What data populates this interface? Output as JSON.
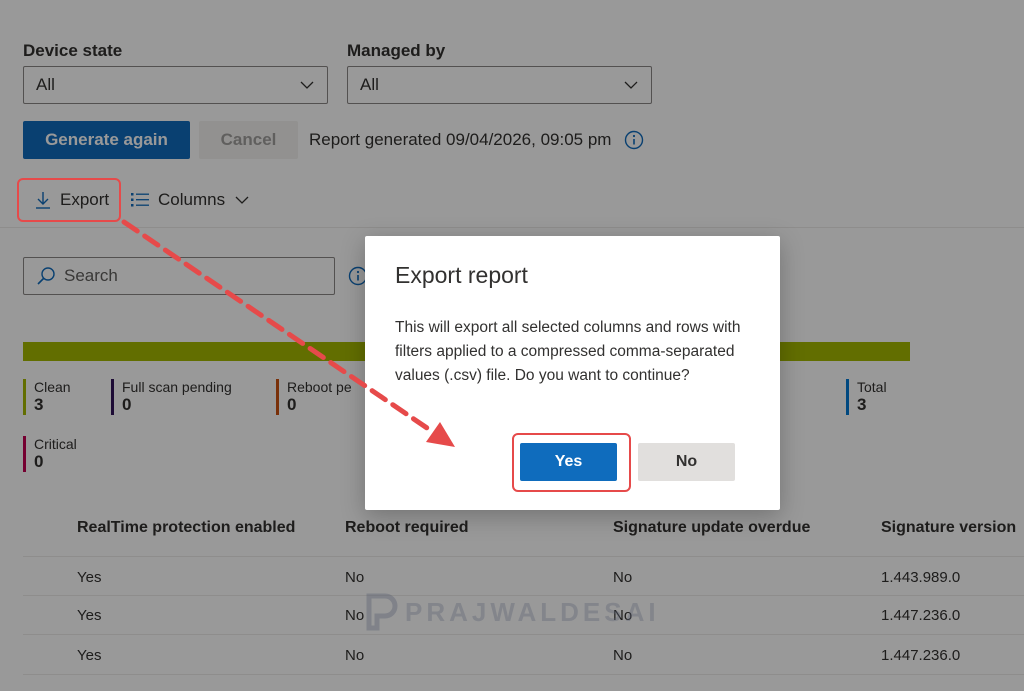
{
  "filters": {
    "device_state": {
      "label": "Device state",
      "value": "All"
    },
    "managed_by": {
      "label": "Managed by",
      "value": "All"
    }
  },
  "actions": {
    "generate_label": "Generate again",
    "cancel_label": "Cancel",
    "report_status": "Report generated 09/04/2026, 09:05 pm"
  },
  "commands": {
    "export_label": "Export",
    "columns_label": "Columns"
  },
  "search": {
    "placeholder": "Search"
  },
  "summary": {
    "bar_color": "#a4b800",
    "metrics": [
      {
        "name": "Clean",
        "value": "3",
        "color": "#a4b800"
      },
      {
        "name": "Full scan pending",
        "value": "0",
        "color": "#32145a"
      },
      {
        "name": "Reboot pe",
        "value": "0",
        "color": "#ca5010"
      },
      {
        "name": "Total",
        "value": "3",
        "color": "#0078d4"
      },
      {
        "name": "Critical",
        "value": "0",
        "color": "#c30052"
      }
    ]
  },
  "table": {
    "columns": [
      "RealTime protection enabled",
      "Reboot required",
      "Signature update overdue",
      "Signature version"
    ],
    "rows": [
      [
        "Yes",
        "No",
        "No",
        "1.443.989.0"
      ],
      [
        "Yes",
        "No",
        "No",
        "1.447.236.0"
      ],
      [
        "Yes",
        "No",
        "No",
        "1.447.236.0"
      ]
    ]
  },
  "dialog": {
    "title": "Export report",
    "body": "This will export all selected columns and rows with filters applied to a compressed comma-separated values (.csv) file. Do you want to continue?",
    "yes_label": "Yes",
    "no_label": "No"
  },
  "watermark": {
    "text": "PRAJWALDESAI"
  },
  "annotation_color": "#e64a4a"
}
